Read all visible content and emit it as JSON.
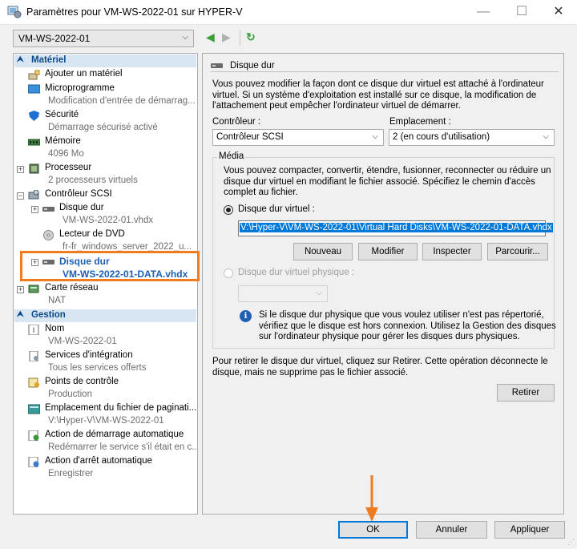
{
  "window": {
    "title": "Paramètres pour VM-WS-2022-01 sur HYPER-V",
    "minimize": "—",
    "maximize": "☐",
    "close": "✕"
  },
  "vm_selector": {
    "value": "VM-WS-2022-01"
  },
  "tree": {
    "hardware_header": "Matériel",
    "add_hardware": "Ajouter un matériel",
    "firmware": {
      "label": "Microprogramme",
      "sub": "Modification d'entrée de démarrag..."
    },
    "security": {
      "label": "Sécurité",
      "sub": "Démarrage sécurisé activé"
    },
    "memory": {
      "label": "Mémoire",
      "sub": "4096 Mo"
    },
    "processor": {
      "label": "Processeur",
      "sub": "2 processeurs virtuels"
    },
    "scsi": {
      "label": "Contrôleur SCSI"
    },
    "disk1": {
      "label": "Disque dur",
      "sub": "VM-WS-2022-01.vhdx"
    },
    "dvd": {
      "label": "Lecteur de DVD",
      "sub": "fr-fr_windows_server_2022_u..."
    },
    "disk2": {
      "label": "Disque dur",
      "sub": "VM-WS-2022-01-DATA.vhdx"
    },
    "network": {
      "label": "Carte réseau",
      "sub": "NAT"
    },
    "management_header": "Gestion",
    "name": {
      "label": "Nom",
      "sub": "VM-WS-2022-01"
    },
    "integration": {
      "label": "Services d'intégration",
      "sub": "Tous les services offerts"
    },
    "checkpoints": {
      "label": "Points de contrôle",
      "sub": "Production"
    },
    "paging": {
      "label": "Emplacement du fichier de paginati...",
      "sub": "V:\\Hyper-V\\VM-WS-2022-01"
    },
    "autostart": {
      "label": "Action de démarrage automatique",
      "sub": "Redémarrer le service s'il était en c..."
    },
    "autostop": {
      "label": "Action d'arrêt automatique",
      "sub": "Enregistrer"
    }
  },
  "panel": {
    "title": "Disque dur",
    "intro": [
      "Vous pouvez modifier la façon dont ce disque dur virtuel est attaché à l'ordinateur",
      "virtuel. Si un système d'exploitation est installé sur ce disque, la modification de",
      "l'attachement peut empêcher l'ordinateur virtuel de démarrer."
    ],
    "controller_label": "Contrôleur :",
    "controller_value": "Contrôleur SCSI",
    "location_label": "Emplacement :",
    "location_value": "2 (en cours d'utilisation)",
    "media_title": "Média",
    "media_text": [
      "Vous pouvez compacter, convertir, étendre, fusionner, reconnecter ou réduire un",
      "disque dur virtuel en modifiant le fichier associé. Spécifiez le chemin d'accès",
      "complet au fichier."
    ],
    "vhd_label": "Disque dur virtuel :",
    "vhd_path": "V:\\Hyper-V\\VM-WS-2022-01\\Virtual Hard Disks\\VM-WS-2022-01-DATA.vhdx",
    "btn_new": "Nouveau",
    "btn_edit": "Modifier",
    "btn_inspect": "Inspecter",
    "btn_browse": "Parcourir...",
    "physical_label": "Disque dur virtuel physique :",
    "info_text": [
      "Si le disque dur physique que vous voulez utiliser n'est pas répertorié,",
      "vérifiez que le disque est hors connexion. Utilisez la Gestion des disques",
      "sur l'ordinateur physique pour gérer les disques durs physiques."
    ],
    "remove_text": [
      "Pour retirer le disque dur virtuel, cliquez sur Retirer. Cette opération déconnecte le",
      "disque, mais ne supprime pas le fichier associé."
    ],
    "btn_remove": "Retirer"
  },
  "footer": {
    "ok": "OK",
    "cancel": "Annuler",
    "apply": "Appliquer"
  },
  "colors": {
    "highlight": "#f07c22",
    "accent": "#0078d7",
    "selected_text": "#1a5fb4",
    "section_bg": "#d8e6f4"
  }
}
